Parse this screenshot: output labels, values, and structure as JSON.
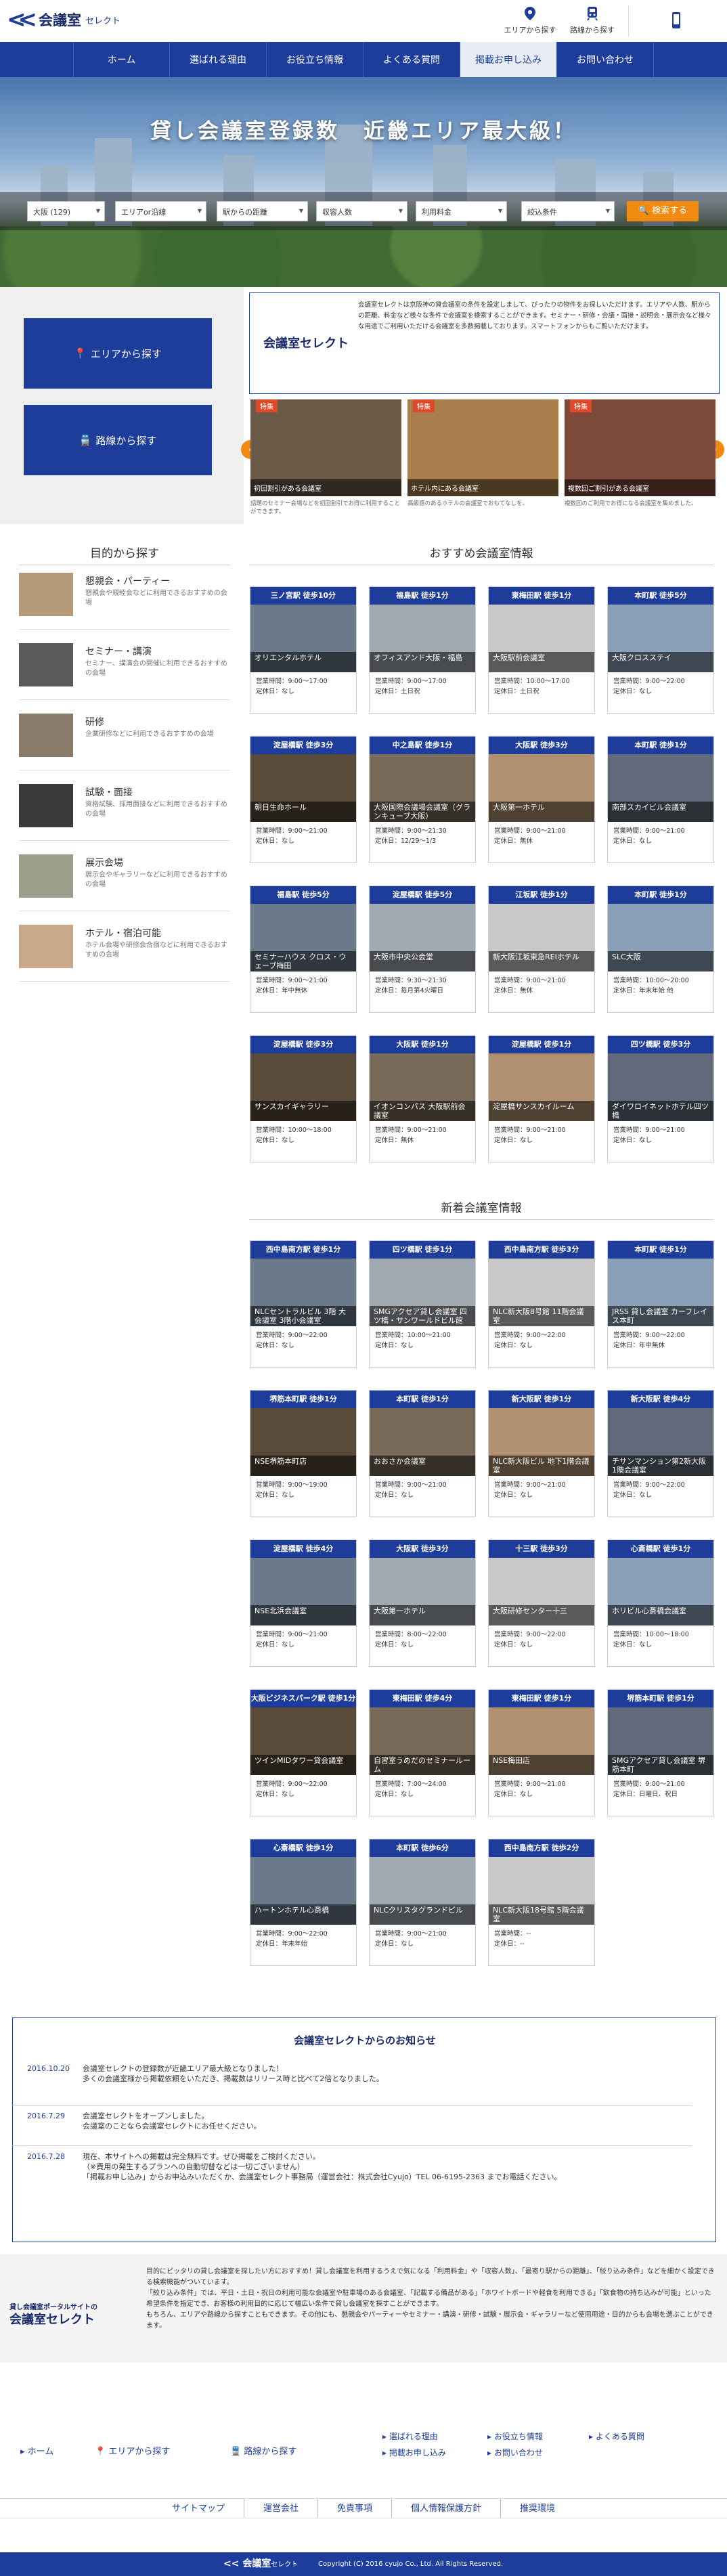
{
  "brand": {
    "name": "会議室",
    "sub": "セレクト"
  },
  "header": {
    "area_btn": "エリアから探す",
    "line_btn": "路線から探す"
  },
  "nav": [
    "ホーム",
    "選ばれる理由",
    "お役立ち情報",
    "よくある質問",
    "掲載お申し込み",
    "お問い合わせ"
  ],
  "hero": {
    "catch": "貸し会議室登録数　近畿エリア最大級！",
    "selects": [
      "大阪 (129)",
      "エリアor沿線",
      "駅からの距離",
      "収容人数",
      "利用料金",
      "絞込条件"
    ],
    "search_btn": "検索する"
  },
  "side": {
    "area": "エリアから探す",
    "line": "路線から探す"
  },
  "intro": {
    "logo": "会議室セレクト",
    "text": "会議室セレクトは京阪神の貸会議室の条件を設定しまして、ぴったりの物件をお探しいただけます。エリアや人数、駅からの距離、料金など様々な条件で会議室を検索することができます。セミナー・研修・会議・面接・説明会・展示会など様々な用途でご利用いただける会議室を多数掲載しております。スマートフォンからもご覧いただけます。"
  },
  "features": [
    {
      "tag": "特集",
      "caption": "初回割引がある会議室",
      "desc": "話題のセミナー会場などを初回割引でお得に利用することができます。"
    },
    {
      "tag": "特集",
      "caption": "ホテル内にある会議室",
      "desc": "高級感のあるホテルの会議室でおもてなしを。"
    },
    {
      "tag": "特集",
      "caption": "複数回ご割引がある会議室",
      "desc": "複数回のご利用でお得になる会議室を集めました。"
    }
  ],
  "purpose": {
    "title": "目的から探す",
    "items": [
      {
        "t": "懇親会・パーティー",
        "d": "懇親会や親睦会などに利用できるおすすめの会場"
      },
      {
        "t": "セミナー・講演",
        "d": "セミナー、講演会の開催に利用できるおすすめの会場"
      },
      {
        "t": "研修",
        "d": "企業研修などに利用できるおすすめの会場"
      },
      {
        "t": "試験・面接",
        "d": "資格試験、採用面接などに利用できるおすすめの会場"
      },
      {
        "t": "展示会場",
        "d": "展示会やギャラリーなどに利用できるおすすめの会場"
      },
      {
        "t": "ホテル・宿泊可能",
        "d": "ホテル会場や研修会合宿などに利用できるおすすめの会場"
      }
    ]
  },
  "recommend": {
    "title": "おすすめ会議室情報",
    "cards": [
      {
        "st": "三ノ宮駅 徒歩10分",
        "nm": "オリエンタルホテル",
        "h": "営業時間：9:00〜17:00",
        "c": "定休日：なし"
      },
      {
        "st": "福島駅 徒歩1分",
        "nm": "オフィスアンド大阪・福島",
        "h": "営業時間：9:00〜17:00",
        "c": "定休日：土日祝"
      },
      {
        "st": "東梅田駅 徒歩1分",
        "nm": "大阪駅前会議室",
        "h": "営業時間：10:00〜17:00",
        "c": "定休日：土日祝"
      },
      {
        "st": "本町駅 徒歩5分",
        "nm": "大阪クロスステイ",
        "h": "営業時間：9:00〜22:00",
        "c": "定休日：なし"
      },
      {
        "st": "淀屋橋駅 徒歩3分",
        "nm": "朝日生命ホール",
        "h": "営業時間：9:00〜21:00",
        "c": "定休日：なし"
      },
      {
        "st": "中之島駅 徒歩1分",
        "nm": "大阪国際会議場会議室（グランキューブ大阪）",
        "h": "営業時間：9:00〜21:30",
        "c": "定休日：12/29〜1/3"
      },
      {
        "st": "大阪駅 徒歩3分",
        "nm": "大阪第一ホテル",
        "h": "営業時間：9:00〜21:00",
        "c": "定休日：無休"
      },
      {
        "st": "本町駅 徒歩1分",
        "nm": "南部スカイビル会議室",
        "h": "営業時間：9:00〜21:00",
        "c": "定休日：なし"
      },
      {
        "st": "福島駅 徒歩5分",
        "nm": "セミナーハウス クロス・ウェーブ梅田",
        "h": "営業時間：9:00〜21:00",
        "c": "定休日：年中無休"
      },
      {
        "st": "淀屋橋駅 徒歩5分",
        "nm": "大阪市中央公会堂",
        "h": "営業時間：9:30〜21:30",
        "c": "定休日：毎月第4火曜日"
      },
      {
        "st": "江坂駅 徒歩1分",
        "nm": "新大阪江坂東急REIホテル",
        "h": "営業時間：9:00〜21:00",
        "c": "定休日：無休"
      },
      {
        "st": "本町駅 徒歩1分",
        "nm": "SLC大阪",
        "h": "営業時間：10:00〜20:00",
        "c": "定休日：年末年始 他"
      },
      {
        "st": "淀屋橋駅 徒歩3分",
        "nm": "サンスカイギャラリー",
        "h": "営業時間：10:00〜18:00",
        "c": "定休日：なし"
      },
      {
        "st": "大阪駅 徒歩1分",
        "nm": "イオンコンパス 大阪駅前会議室",
        "h": "営業時間：9:00〜21:00",
        "c": "定休日：無休"
      },
      {
        "st": "淀屋橋駅 徒歩1分",
        "nm": "淀屋橋サンスカイルーム",
        "h": "営業時間：9:00〜21:00",
        "c": "定休日：なし"
      },
      {
        "st": "四ツ橋駅 徒歩3分",
        "nm": "ダイワロイネットホテル四ツ橋",
        "h": "営業時間：9:00〜21:00",
        "c": "定休日：なし"
      }
    ]
  },
  "newarrivals": {
    "title": "新着会議室情報",
    "cards": [
      {
        "st": "西中島南方駅 徒歩1分",
        "nm": "NLCセントラルビル 3階 大会議室 3階小会議室",
        "h": "営業時間：9:00〜22:00",
        "c": "定休日：なし"
      },
      {
        "st": "四ツ橋駅 徒歩1分",
        "nm": "SMGアクセア貸し会議室 四ツ橋・サンワールドビル館",
        "h": "営業時間：10:00〜21:00",
        "c": "定休日：なし"
      },
      {
        "st": "西中島南方駅 徒歩3分",
        "nm": "NLC新大阪8号館 11階会議室",
        "h": "営業時間：9:00〜22:00",
        "c": "定休日：なし"
      },
      {
        "st": "本町駅 徒歩1分",
        "nm": "JRSS 貸し会議室 カーフレイス本町",
        "h": "営業時間：9:00〜22:00",
        "c": "定休日：年中無休"
      },
      {
        "st": "堺筋本町駅 徒歩1分",
        "nm": "NSE堺筋本町店",
        "h": "営業時間：9:00〜19:00",
        "c": "定休日：なし"
      },
      {
        "st": "本町駅 徒歩1分",
        "nm": "おおさか会議室",
        "h": "営業時間：9:00〜21:00",
        "c": "定休日：なし"
      },
      {
        "st": "新大阪駅 徒歩1分",
        "nm": "NLC新大阪ビル 地下1階会議室",
        "h": "営業時間：9:00〜21:00",
        "c": "定休日：なし"
      },
      {
        "st": "新大阪駅 徒歩4分",
        "nm": "チサンマンション第2新大阪 1階会議室",
        "h": "営業時間：9:00〜22:00",
        "c": "定休日：なし"
      },
      {
        "st": "淀屋橋駅 徒歩4分",
        "nm": "NSE北浜会議室",
        "h": "営業時間：9:00〜21:00",
        "c": "定休日：なし"
      },
      {
        "st": "大阪駅 徒歩3分",
        "nm": "大阪第一ホテル",
        "h": "営業時間：8:00〜22:00",
        "c": "定休日：なし"
      },
      {
        "st": "十三駅 徒歩3分",
        "nm": "大阪研修センター十三",
        "h": "営業時間：9:00〜22:00",
        "c": "定休日：なし"
      },
      {
        "st": "心斎橋駅 徒歩1分",
        "nm": "ホリビル心斎橋会議室",
        "h": "営業時間：10:00〜18:00",
        "c": "定休日：なし"
      },
      {
        "st": "大阪ビジネスパーク駅 徒歩1分",
        "nm": "ツインMIDタワー貸会議室",
        "h": "営業時間：9:00〜22:00",
        "c": "定休日：なし"
      },
      {
        "st": "東梅田駅 徒歩4分",
        "nm": "自習室うめだのセミナールーム",
        "h": "営業時間：7:00〜24:00",
        "c": "定休日：なし"
      },
      {
        "st": "東梅田駅 徒歩1分",
        "nm": "NSE梅田店",
        "h": "営業時間：9:00〜21:00",
        "c": "定休日：なし"
      },
      {
        "st": "堺筋本町駅 徒歩1分",
        "nm": "SMGアクセア貸し会議室 堺筋本町",
        "h": "営業時間：9:00〜21:00",
        "c": "定休日：日曜日、祝日"
      },
      {
        "st": "心斎橋駅 徒歩1分",
        "nm": "ハートンホテル心斎橋",
        "h": "営業時間：9:00〜22:00",
        "c": "定休日：年末年始"
      },
      {
        "st": "本町駅 徒歩6分",
        "nm": "NLCクリスタグランドビル",
        "h": "営業時間：9:00〜21:00",
        "c": "定休日：なし"
      },
      {
        "st": "西中島南方駅 徒歩2分",
        "nm": "NLC新大阪18号館 5階会議室",
        "h": "営業時間：--",
        "c": "定休日：--"
      }
    ]
  },
  "news": {
    "title": "会議室セレクトからのお知らせ",
    "items": [
      {
        "d": "2016.10.20",
        "b": "会議室セレクトの登録数が近畿エリア最大級となりました！\n多くの会議室様から掲載依頼をいただき、掲載数はリリース時と比べて2倍となりました。"
      },
      {
        "d": "2016.7.29",
        "b": "会議室セレクトをオープンしました。\n会議室のことなら会議室セレクトにお任せください。"
      },
      {
        "d": "2016.7.28",
        "b": "現在、本サイトへの掲載は完全無料です。ぜひ掲載をご検討ください。\n（※費用の発生するプランへの自動切替などは一切ございません）\n「掲載お申し込み」からお申込みいただくか、会議室セレクト事務局（運営会社：株式会社Cyujo）TEL 06-6195-2363 までお電話ください。"
      }
    ]
  },
  "about": {
    "label1": "貸し会議室ポータルサイトの",
    "label2": "会議室セレクト",
    "text": "目的にピッタリの貸し会議室を探したい方におすすめ！貸し会議室を利用するうえで気になる「利用料金」や「収容人数」、「最寄り駅からの距離」、「絞り込み条件」などを細かく設定できる検索機能がついています。\n「絞り込み条件」では、平日・土日・祝日の利用可能な会議室や駐車場のある会議室、「記載する備品がある」「ホワイトボードや軽食を利用できる」「飲食物の持ち込みが可能」といった希望条件を指定でき、お客様の利用目的に応じて幅広い条件で貸し会議室を探すことができます。\nもちろん、エリアや路線から探すこともできます。その他にも、懇親会やパーティーやセミナー・講演・研修・試験・展示会・ギャラリーなど使用用途・目的からも会場を選ぶことができます。"
  },
  "footer": {
    "links_left": [
      "ホーム",
      "エリアから探す",
      "路線から探す"
    ],
    "links_mid": [
      "選ばれる理由",
      "掲載お申し込み",
      "お役立ち情報",
      "お問い合わせ",
      "よくある質問"
    ],
    "bottom": [
      "サイトマップ",
      "運営会社",
      "免責事項",
      "個人情報保護方針",
      "推奨環境"
    ],
    "copyright": "Copyright (C) 2016 cyujo Co., Ltd. All Rights Reserved."
  },
  "colors": {
    "brand": "#1e3d9a",
    "accent": "#f08a10"
  }
}
